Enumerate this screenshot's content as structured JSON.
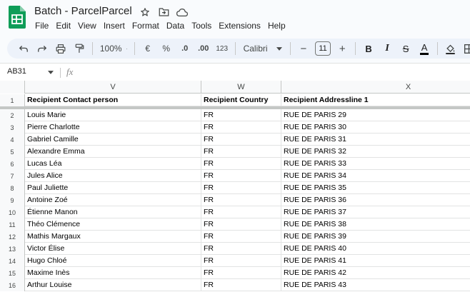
{
  "app": {
    "doc_title": "Batch - ParcelParcel",
    "menus": [
      "File",
      "Edit",
      "View",
      "Insert",
      "Format",
      "Data",
      "Tools",
      "Extensions",
      "Help"
    ]
  },
  "toolbar": {
    "zoom": "100%",
    "currency": "€",
    "percent": "%",
    "dec_decrease": ".0",
    "dec_increase": ".00",
    "number_format": "123",
    "font": "Calibri",
    "font_size": "11",
    "font_minus": "−",
    "font_plus": "+",
    "bold": "B",
    "italic": "I",
    "strike": "S",
    "text_color": "A"
  },
  "formula_bar": {
    "name_box": "AB31",
    "fx": "fx"
  },
  "columns": [
    "V",
    "W",
    "X"
  ],
  "header_row": {
    "num": "1",
    "cells": [
      "Recipient Contact person",
      "Recipient Country",
      "Recipient Addressline 1"
    ]
  },
  "rows": [
    {
      "num": "2",
      "cells": [
        "Louis Marie",
        "FR",
        "RUE DE PARIS 29"
      ]
    },
    {
      "num": "3",
      "cells": [
        "Pierre Charlotte",
        "FR",
        "RUE DE PARIS 30"
      ]
    },
    {
      "num": "4",
      "cells": [
        "Gabriel Camille",
        "FR",
        "RUE DE PARIS 31"
      ]
    },
    {
      "num": "5",
      "cells": [
        "Alexandre Emma",
        "FR",
        "RUE DE PARIS 32"
      ]
    },
    {
      "num": "6",
      "cells": [
        "Lucas Léa",
        "FR",
        "RUE DE PARIS 33"
      ]
    },
    {
      "num": "7",
      "cells": [
        "Jules Alice",
        "FR",
        "RUE DE PARIS 34"
      ]
    },
    {
      "num": "8",
      "cells": [
        "Paul Juliette",
        "FR",
        "RUE DE PARIS 35"
      ]
    },
    {
      "num": "9",
      "cells": [
        "Antoine Zoé",
        "FR",
        "RUE DE PARIS 36"
      ]
    },
    {
      "num": "10",
      "cells": [
        "Étienne Manon",
        "FR",
        "RUE DE PARIS 37"
      ]
    },
    {
      "num": "11",
      "cells": [
        "Théo Clémence",
        "FR",
        "RUE DE PARIS 38"
      ]
    },
    {
      "num": "12",
      "cells": [
        "Mathis Margaux",
        "FR",
        "RUE DE PARIS 39"
      ]
    },
    {
      "num": "13",
      "cells": [
        "Victor Élise",
        "FR",
        "RUE DE PARIS 40"
      ]
    },
    {
      "num": "14",
      "cells": [
        "Hugo Chloé",
        "FR",
        "RUE DE PARIS 41"
      ]
    },
    {
      "num": "15",
      "cells": [
        "Maxime Inès",
        "FR",
        "RUE DE PARIS 42"
      ]
    },
    {
      "num": "16",
      "cells": [
        "Arthur Louise",
        "FR",
        "RUE DE PARIS 43"
      ]
    }
  ],
  "colors": {
    "sheets_green": "#0f9d58",
    "toolbar_bg": "#edf2fa",
    "header_bg": "#f8f9fa",
    "gridline": "#e2e3e3"
  }
}
